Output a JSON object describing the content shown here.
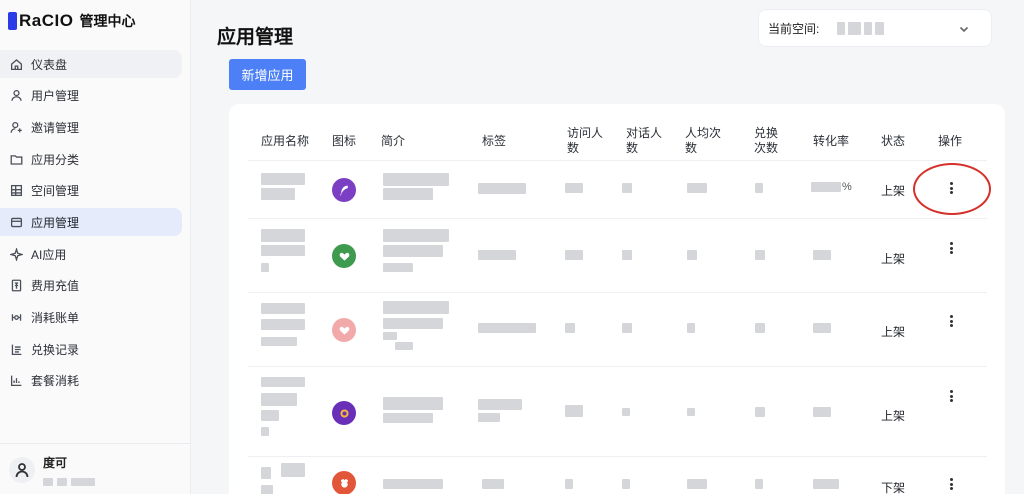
{
  "logo": {
    "brand": "RaCIO",
    "subtitle": "管理中心",
    "brand_color": "#2b3be8"
  },
  "sidebar": {
    "items": [
      {
        "label": "仪表盘",
        "icon": "home-icon"
      },
      {
        "label": "用户管理",
        "icon": "user-icon"
      },
      {
        "label": "邀请管理",
        "icon": "user-plus-icon"
      },
      {
        "label": "应用分类",
        "icon": "folder-icon"
      },
      {
        "label": "空间管理",
        "icon": "grid-icon"
      },
      {
        "label": "应用管理",
        "icon": "window-icon",
        "active": true
      },
      {
        "label": "AI应用",
        "icon": "sparkle-icon"
      },
      {
        "label": "费用充值",
        "icon": "receipt-icon"
      },
      {
        "label": "消耗账单",
        "icon": "bill-icon"
      },
      {
        "label": "兑换记录",
        "icon": "list-icon"
      },
      {
        "label": "套餐消耗",
        "icon": "bar-chart-icon"
      }
    ],
    "user": {
      "name": "度可",
      "icon": "user-avatar-icon"
    }
  },
  "header": {
    "title": "应用管理",
    "space_label": "当前空间:",
    "space_dropdown_icon": "chevron-down-icon"
  },
  "toolbar": {
    "add_label": "新增应用",
    "accent": "#4d80f6"
  },
  "table": {
    "columns": [
      "应用名称",
      "图标",
      "简介",
      "标签",
      "访问人数",
      "对话人数",
      "人均次数",
      "兑换次数",
      "转化率",
      "状态",
      "操作"
    ],
    "rows": [
      {
        "status": "上架",
        "icon_color": "#7b3fc4",
        "icon": "feather-icon",
        "rate_suffix": "%",
        "highlighted": true
      },
      {
        "status": "上架",
        "icon_color": "#3d9a4f",
        "icon": "heart-hands-icon"
      },
      {
        "status": "上架",
        "icon_color": "#f2a9a9",
        "icon": "heart-hands-icon"
      },
      {
        "status": "上架",
        "icon_color": "#6a2fb8",
        "icon": "coin-icon"
      },
      {
        "status": "下架",
        "icon_color": "#e2563a",
        "icon": "chef-icon"
      }
    ]
  }
}
